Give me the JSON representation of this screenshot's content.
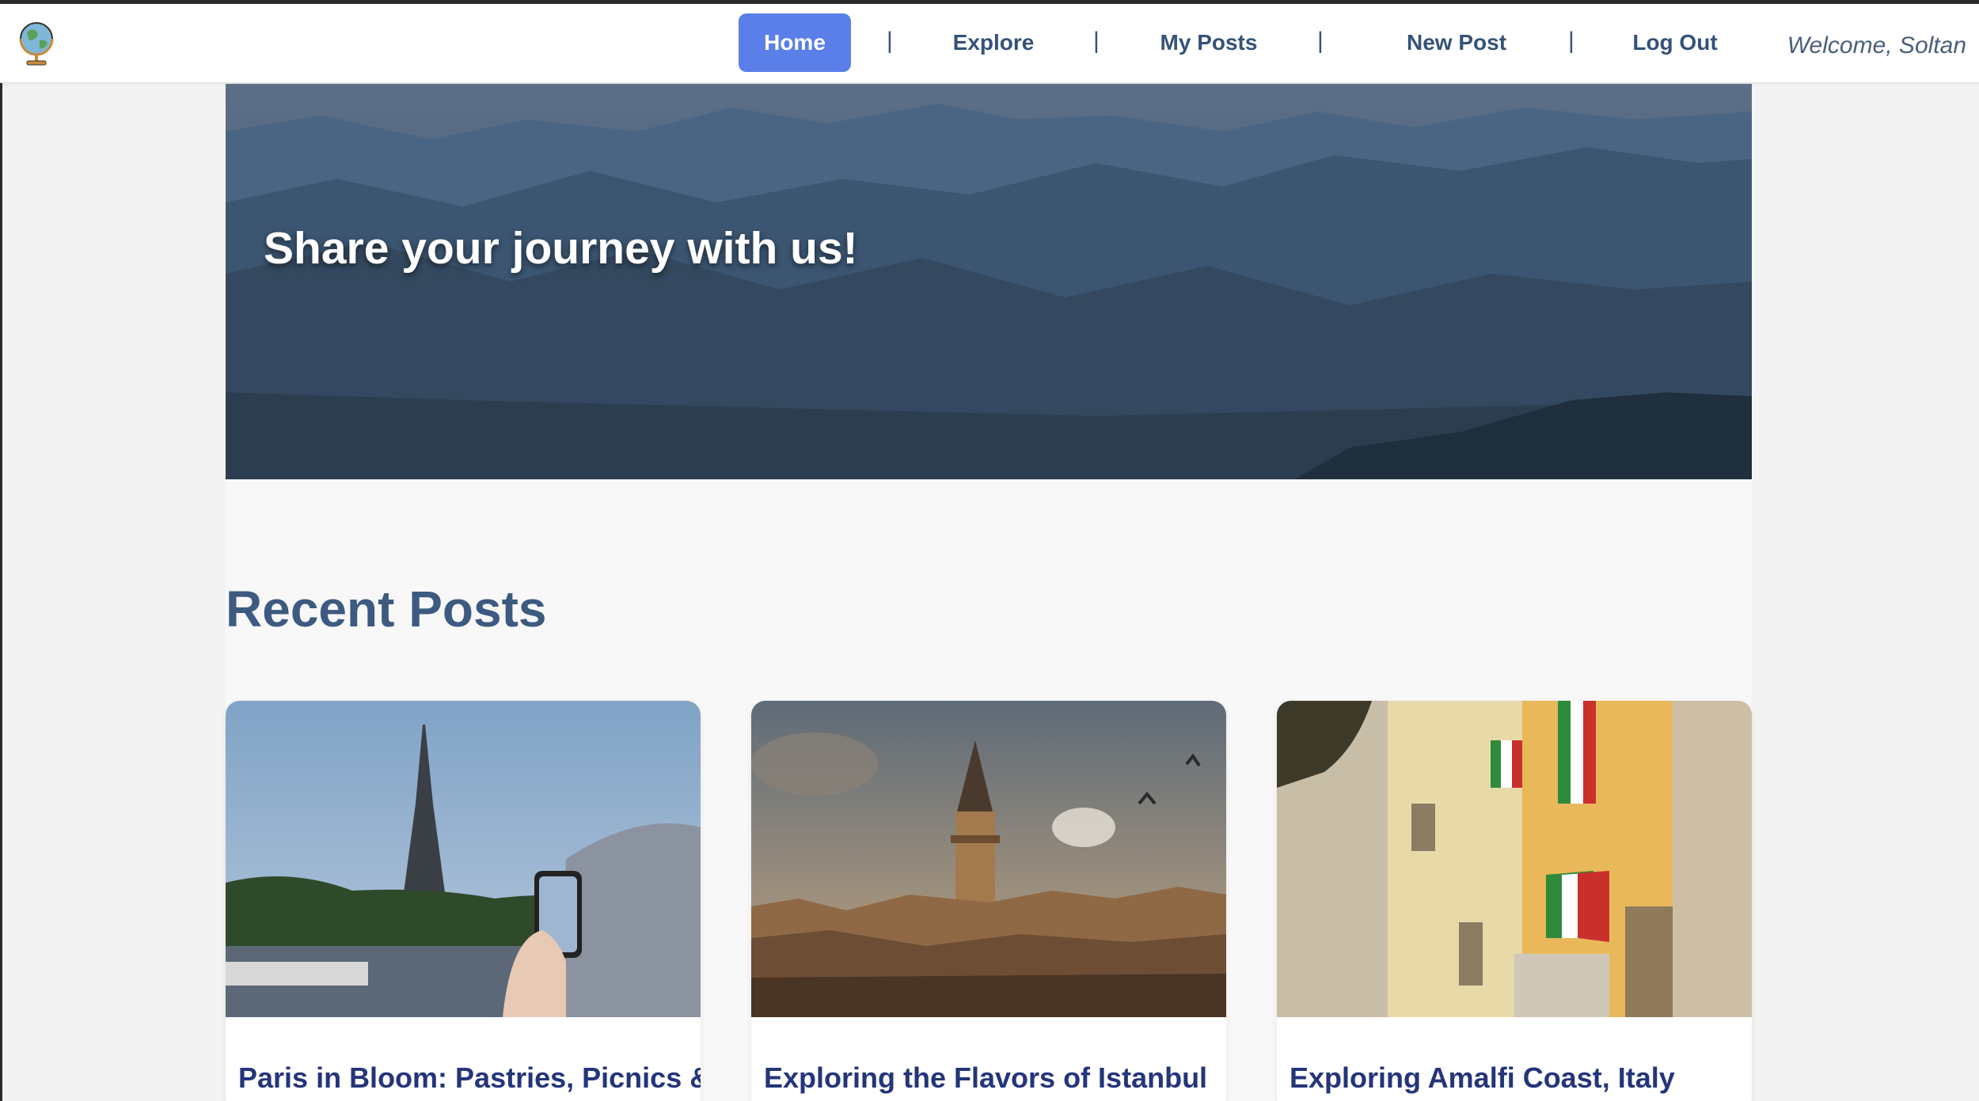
{
  "nav": {
    "logo_icon": "globe-icon",
    "items": [
      {
        "label": "Home",
        "active": true
      },
      {
        "label": "Explore",
        "active": false
      },
      {
        "label": "My Posts",
        "active": false
      },
      {
        "label": "New Post",
        "active": false
      },
      {
        "label": "Log Out",
        "active": false
      }
    ],
    "separator": "|",
    "welcome": "Welcome, Soltan"
  },
  "hero": {
    "title": "Share your journey with us!",
    "image": "mountain-landscape-image"
  },
  "recent": {
    "heading": "Recent Posts",
    "posts": [
      {
        "title": "Paris in Bloom: Pastries, Picnics &",
        "image": "eiffel-tower-photo"
      },
      {
        "title": "Exploring the Flavors of Istanbul",
        "image": "galata-tower-photo"
      },
      {
        "title": "Exploring Amalfi Coast, Italy",
        "image": "italian-street-flags-photo"
      }
    ]
  },
  "colors": {
    "accent": "#5b7fe8",
    "nav_text": "#34527a",
    "heading": "#3d5a80",
    "card_title": "#24357a"
  }
}
